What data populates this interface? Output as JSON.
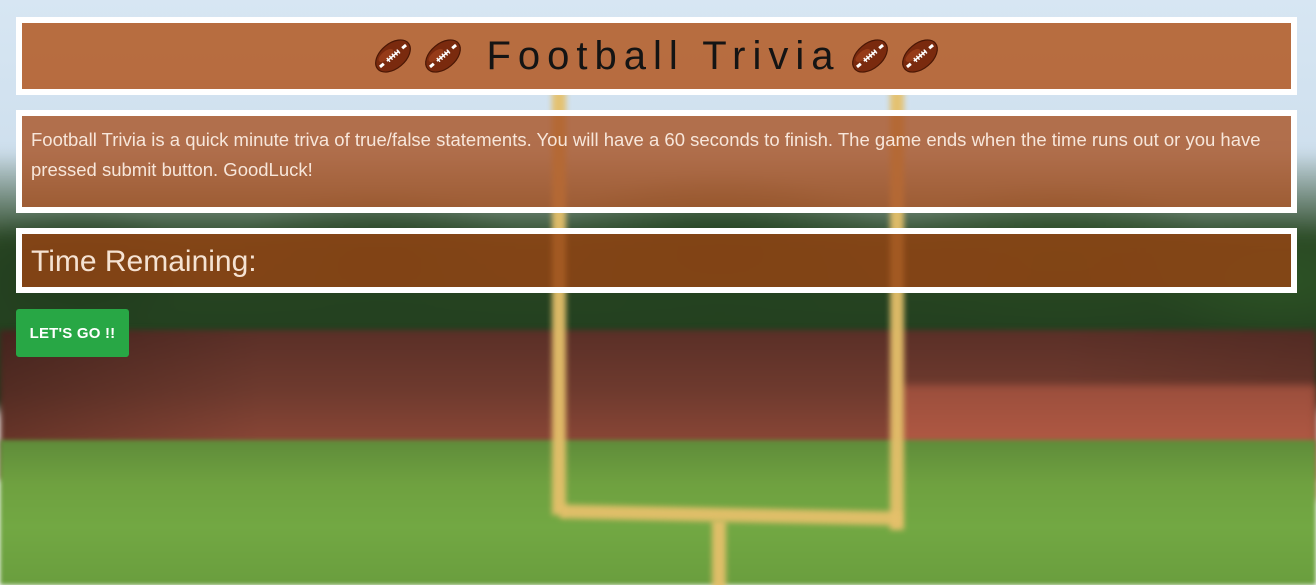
{
  "header": {
    "title": "Football Trivia",
    "icons_left": [
      "football-icon",
      "football-icon"
    ],
    "icons_right": [
      "football-icon",
      "football-icon"
    ]
  },
  "description": {
    "text": "Football Trivia is a quick minute triva of true/false statements. You will have a 60 seconds to finish. The game ends when the time runs out or you have pressed submit button. GoodLuck!"
  },
  "timer": {
    "label": "Time Remaining:",
    "value": ""
  },
  "actions": {
    "start_label": "LET'S GO !!"
  },
  "colors": {
    "panel_border": "#ffffff",
    "panel_fill": "#b6683a",
    "button_green": "#28a745"
  }
}
